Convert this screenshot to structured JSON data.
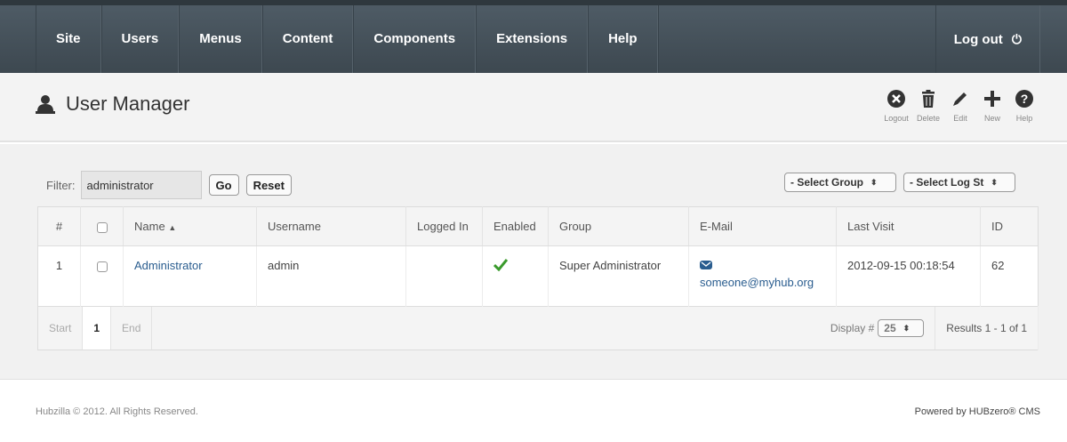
{
  "nav": {
    "items": [
      "Site",
      "Users",
      "Menus",
      "Content",
      "Components",
      "Extensions",
      "Help"
    ],
    "logout_label": "Log out"
  },
  "header": {
    "title": "User Manager",
    "toolbar": [
      {
        "label": "Logout",
        "icon": "logout-icon"
      },
      {
        "label": "Delete",
        "icon": "trash-icon"
      },
      {
        "label": "Edit",
        "icon": "pencil-icon"
      },
      {
        "label": "New",
        "icon": "plus-icon"
      },
      {
        "label": "Help",
        "icon": "help-icon"
      }
    ]
  },
  "filter": {
    "label": "Filter:",
    "value": "administrator",
    "go_label": "Go",
    "reset_label": "Reset",
    "select_group": "- Select Group",
    "select_log": "- Select Log St"
  },
  "table": {
    "columns": [
      "#",
      "",
      "Name",
      "Username",
      "Logged In",
      "Enabled",
      "Group",
      "E-Mail",
      "Last Visit",
      "ID"
    ],
    "rows": [
      {
        "num": "1",
        "name": "Administrator",
        "username": "admin",
        "logged_in": "",
        "enabled": "true",
        "group": "Super Administrator",
        "email": "someone@myhub.org",
        "last_visit": "2012-09-15 00:18:54",
        "id": "62"
      }
    ]
  },
  "pagination": {
    "start": "Start",
    "current": "1",
    "end": "End",
    "display_label": "Display #",
    "display_value": "25",
    "results": "Results 1 - 1 of 1"
  },
  "footer": {
    "left": "Hubzilla © 2012. All Rights Reserved.",
    "right": "Powered by HUBzero® CMS"
  },
  "colors": {
    "topbar": "#46525b",
    "link": "#2a5d8f",
    "enabled_check": "#3a9a2c"
  }
}
